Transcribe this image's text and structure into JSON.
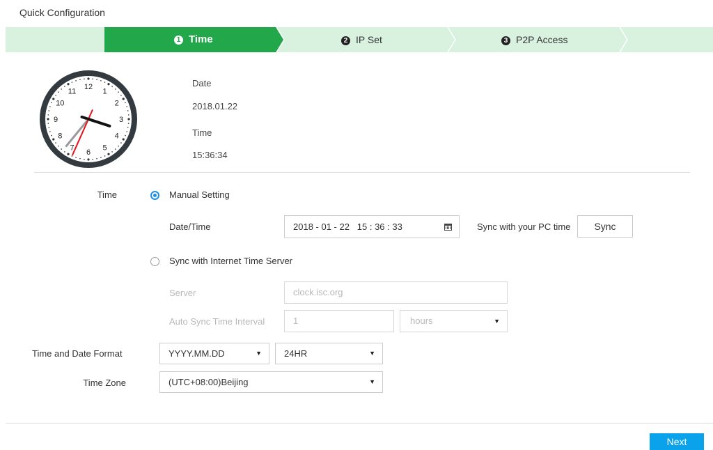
{
  "page": {
    "title": "Quick Configuration"
  },
  "steps": [
    {
      "number": "1",
      "label": "Time",
      "active": true
    },
    {
      "number": "2",
      "label": "IP Set",
      "active": false
    },
    {
      "number": "3",
      "label": "P2P Access",
      "active": false
    }
  ],
  "colors": {
    "step_active": "#22a84a",
    "step_inactive": "#d9f1df",
    "accent_blue": "#0aa2ea",
    "clock_second_hand": "#e8141b"
  },
  "clock": {
    "numbers": [
      "12",
      "1",
      "2",
      "3",
      "4",
      "5",
      "6",
      "7",
      "8",
      "9",
      "10",
      "11"
    ],
    "hour": 15,
    "minute": 36,
    "second": 34
  },
  "info": {
    "date_label": "Date",
    "date_value": "2018.01.22",
    "time_label": "Time",
    "time_value": "15:36:34"
  },
  "time_settings": {
    "label": "Time",
    "manual": {
      "label": "Manual Setting",
      "selected": true,
      "datetime_label": "Date/Time",
      "datetime_value": "2018 - 01 - 22   15 : 36 : 33",
      "calendar_icon": "calendar-icon",
      "sync_pc_label": "Sync with your PC time",
      "sync_button": "Sync"
    },
    "internet": {
      "label": "Sync with Internet Time Server",
      "selected": false,
      "server_label": "Server",
      "server_value": "clock.isc.org",
      "interval_label": "Auto Sync Time Interval",
      "interval_value": "1",
      "interval_unit": "hours"
    }
  },
  "format": {
    "label": "Time and Date Format",
    "date_format": "YYYY.MM.DD",
    "hour_format": "24HR"
  },
  "timezone": {
    "label": "Time Zone",
    "value": "(UTC+08:00)Beijing"
  },
  "footer": {
    "next_button": "Next"
  }
}
